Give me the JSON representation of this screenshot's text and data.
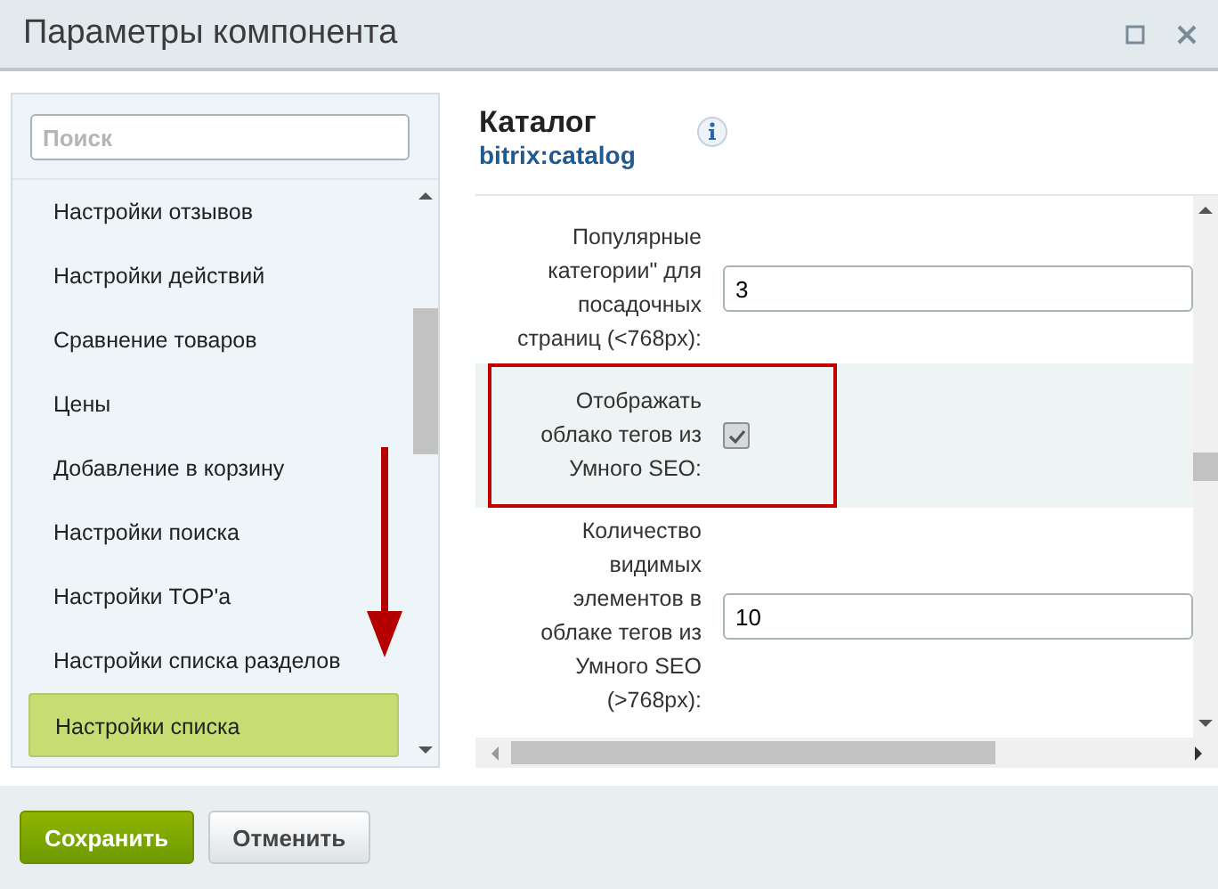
{
  "window": {
    "title": "Параметры компонента"
  },
  "sidebar": {
    "search": {
      "placeholder": "Поиск"
    },
    "items": [
      {
        "label": "Настройки отзывов",
        "selected": false
      },
      {
        "label": "Настройки действий",
        "selected": false
      },
      {
        "label": "Сравнение товаров",
        "selected": false
      },
      {
        "label": "Цены",
        "selected": false
      },
      {
        "label": "Добавление в корзину",
        "selected": false
      },
      {
        "label": "Настройки поиска",
        "selected": false
      },
      {
        "label": "Настройки TOP'а",
        "selected": false
      },
      {
        "label": "Настройки списка разделов",
        "selected": false
      },
      {
        "label": "Настройки списка",
        "selected": true
      }
    ]
  },
  "component": {
    "title": "Каталог",
    "code": "bitrix:catalog"
  },
  "params": [
    {
      "kind": "text",
      "label": "Популярные категории\" для посадочных страниц (<768px):",
      "value": "3",
      "highlighted": false
    },
    {
      "kind": "checkbox",
      "label": "Отображать облако тегов из Умного SEO:",
      "checked": true,
      "highlighted": true
    },
    {
      "kind": "text",
      "label": "Количество видимых элементов в облаке тегов из Умного SEO (>768px):",
      "value": "10",
      "highlighted": false
    }
  ],
  "buttons": [
    {
      "label": "Сохранить",
      "kind": "primary"
    },
    {
      "label": "Отменить",
      "kind": "secondary"
    }
  ]
}
